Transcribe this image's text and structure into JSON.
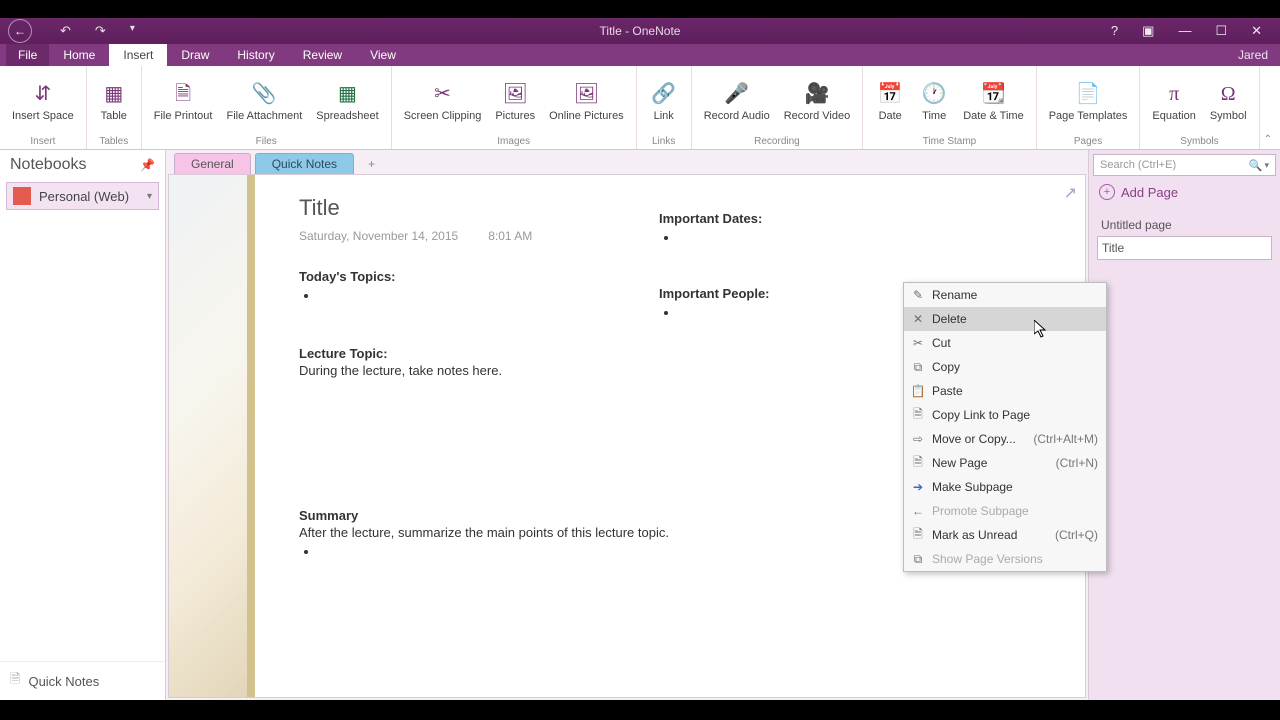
{
  "window": {
    "title": "Title - OneNote",
    "user": "Jared"
  },
  "tabs": {
    "file": "File",
    "home": "Home",
    "insert": "Insert",
    "draw": "Draw",
    "history": "History",
    "review": "Review",
    "view": "View"
  },
  "ribbon": {
    "insert_space": "Insert Space",
    "insert_g": "Insert",
    "table": "Table",
    "tables_g": "Tables",
    "file_printout": "File Printout",
    "file_attachment": "File Attachment",
    "spreadsheet": "Spreadsheet",
    "files_g": "Files",
    "screen_clipping": "Screen Clipping",
    "pictures": "Pictures",
    "online_pictures": "Online Pictures",
    "images_g": "Images",
    "link": "Link",
    "links_g": "Links",
    "record_audio": "Record Audio",
    "record_video": "Record Video",
    "recording_g": "Recording",
    "date": "Date",
    "time": "Time",
    "date_time": "Date & Time",
    "timestamp_g": "Time Stamp",
    "page_templates": "Page Templates",
    "pages_g": "Pages",
    "equation": "Equation",
    "symbol": "Symbol",
    "symbols_g": "Symbols"
  },
  "sidebar": {
    "header": "Notebooks",
    "notebook": "Personal (Web)",
    "quicknotes": "Quick Notes"
  },
  "sections": {
    "general": "General",
    "quicknotes": "Quick Notes",
    "plus": "+"
  },
  "note": {
    "title": "Title",
    "date": "Saturday, November 14, 2015",
    "time": "8:01 AM",
    "today": "Today's Topics:",
    "lecture_topic": "Lecture Topic:",
    "lecture_body": "During the lecture, take notes here.",
    "summary": "Summary",
    "summary_body": "After the lecture, summarize the main points of this lecture topic.",
    "important_dates": "Important Dates:",
    "important_people": "Important People:"
  },
  "pages": {
    "search_ph": "Search (Ctrl+E)",
    "add": "Add Page",
    "p1": "Untitled page",
    "p2": "Title"
  },
  "ctx": {
    "rename": "Rename",
    "delete": "Delete",
    "cut": "Cut",
    "copy": "Copy",
    "paste": "Paste",
    "copylink": "Copy Link to Page",
    "move": "Move or Copy...",
    "move_sc": "(Ctrl+Alt+M)",
    "newpage": "New Page",
    "newpage_sc": "(Ctrl+N)",
    "subpage": "Make Subpage",
    "promote": "Promote Subpage",
    "unread": "Mark as Unread",
    "unread_sc": "(Ctrl+Q)",
    "versions": "Show Page Versions"
  }
}
